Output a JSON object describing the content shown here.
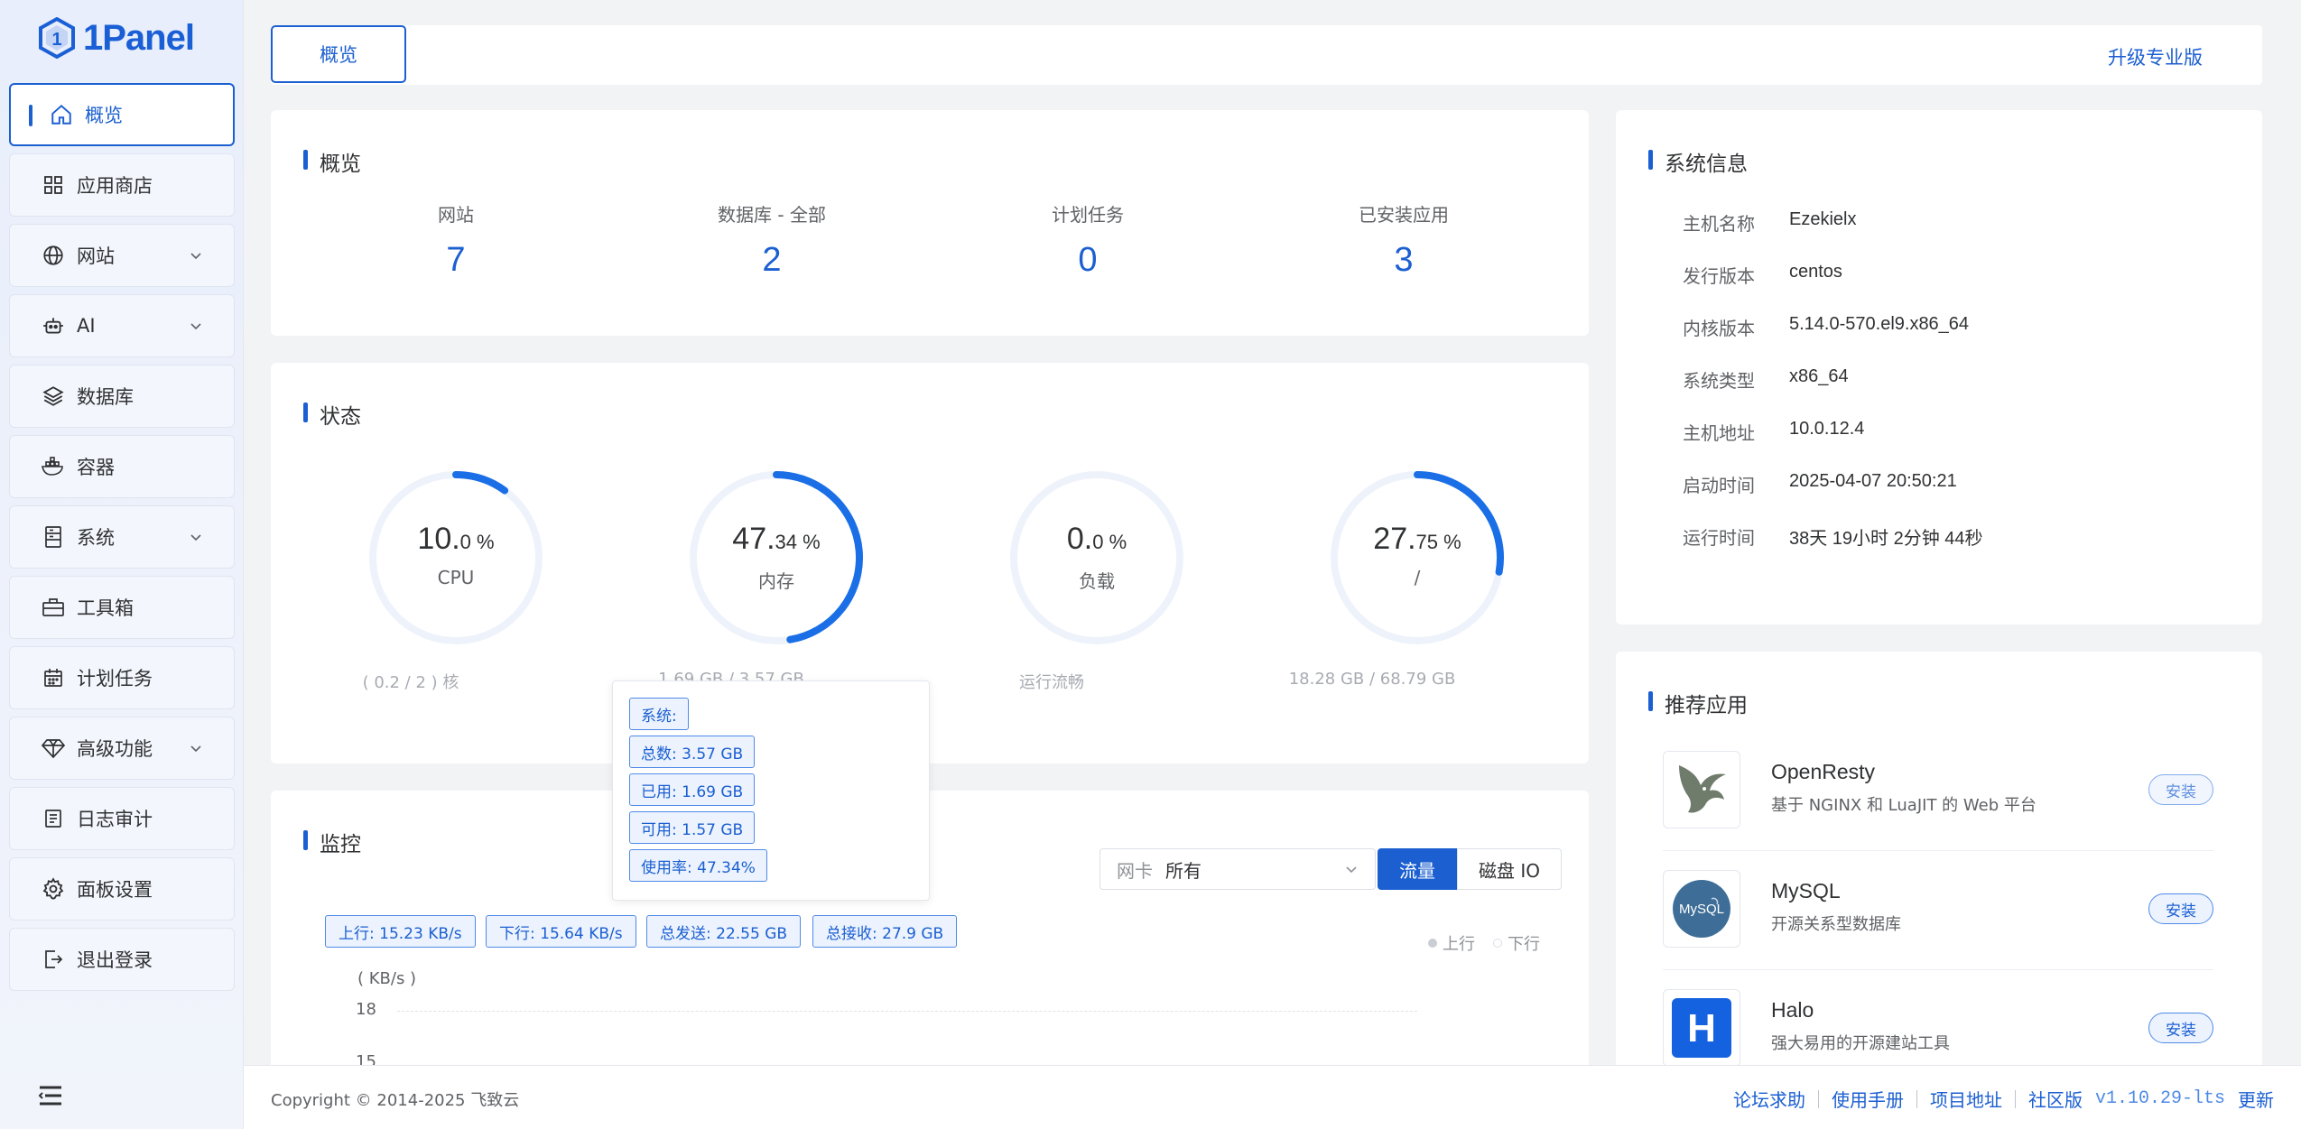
{
  "brand": {
    "name": "1Panel",
    "color": "#1b5fd1"
  },
  "sidebar": {
    "items": [
      {
        "label": "概览",
        "icon": "home-icon",
        "active": true,
        "expandable": false
      },
      {
        "label": "应用商店",
        "icon": "grid-icon",
        "active": false,
        "expandable": false
      },
      {
        "label": "网站",
        "icon": "globe-icon",
        "active": false,
        "expandable": true
      },
      {
        "label": "AI",
        "icon": "robot-icon",
        "active": false,
        "expandable": true
      },
      {
        "label": "数据库",
        "icon": "layers-icon",
        "active": false,
        "expandable": false
      },
      {
        "label": "容器",
        "icon": "docker-icon",
        "active": false,
        "expandable": false
      },
      {
        "label": "系统",
        "icon": "server-icon",
        "active": false,
        "expandable": true
      },
      {
        "label": "工具箱",
        "icon": "toolbox-icon",
        "active": false,
        "expandable": false
      },
      {
        "label": "计划任务",
        "icon": "calendar-icon",
        "active": false,
        "expandable": false
      },
      {
        "label": "高级功能",
        "icon": "diamond-icon",
        "active": false,
        "expandable": true
      },
      {
        "label": "日志审计",
        "icon": "log-icon",
        "active": false,
        "expandable": false
      },
      {
        "label": "面板设置",
        "icon": "gear-icon",
        "active": false,
        "expandable": false
      },
      {
        "label": "退出登录",
        "icon": "logout-icon",
        "active": false,
        "expandable": false
      }
    ]
  },
  "topbar": {
    "tab": "概览",
    "upgrade": "升级专业版"
  },
  "overview": {
    "title": "概览",
    "stats": [
      {
        "label": "网站",
        "value": "7"
      },
      {
        "label": "数据库 - 全部",
        "value": "2"
      },
      {
        "label": "计划任务",
        "value": "0"
      },
      {
        "label": "已安装应用",
        "value": "3"
      }
    ]
  },
  "status": {
    "title": "状态",
    "gauges": [
      {
        "int": "10.",
        "dec": "0 %",
        "label": "CPU",
        "percent": 10.0,
        "sub": "( 0.2 / 2 ) 核"
      },
      {
        "int": "47.",
        "dec": "34 %",
        "label": "内存",
        "percent": 47.34,
        "sub": "1.69 GB / 3.57 GB"
      },
      {
        "int": "0.",
        "dec": "0 %",
        "label": "负载",
        "percent": 0.0,
        "sub": "运行流畅"
      },
      {
        "int": "27.",
        "dec": "75 %",
        "label": "/",
        "percent": 27.75,
        "sub": "18.28 GB / 68.79 GB"
      }
    ]
  },
  "tooltip": {
    "items": [
      "系统:",
      "总数: 3.57 GB",
      "已用: 1.69 GB",
      "可用: 1.57 GB",
      "使用率: 47.34%"
    ]
  },
  "monitor": {
    "title": "监控",
    "nic_prefix": "网卡",
    "nic_value": "所有",
    "btn_traffic": "流量",
    "btn_diskio": "磁盘 IO",
    "tags": [
      "上行: 15.23 KB/s",
      "下行: 15.64 KB/s",
      "总发送: 22.55 GB",
      "总接收: 27.9 GB"
    ],
    "legend": [
      {
        "label": "上行",
        "color": "#c9cdd4"
      },
      {
        "label": "下行",
        "color": "#e6e8eb"
      }
    ],
    "unit": "( KB/s )",
    "y_ticks": [
      "18",
      "15"
    ]
  },
  "sysinfo": {
    "title": "系统信息",
    "rows": [
      {
        "k": "主机名称",
        "v": "Ezekielx"
      },
      {
        "k": "发行版本",
        "v": "centos"
      },
      {
        "k": "内核版本",
        "v": "5.14.0-570.el9.x86_64"
      },
      {
        "k": "系统类型",
        "v": "x86_64"
      },
      {
        "k": "主机地址",
        "v": "10.0.12.4"
      },
      {
        "k": "启动时间",
        "v": "2025-04-07 20:50:21"
      },
      {
        "k": "运行时间",
        "v": "38天 19小时 2分钟 44秒"
      }
    ]
  },
  "apps": {
    "title": "推荐应用",
    "items": [
      {
        "name": "OpenResty",
        "desc": "基于 NGINX 和 LuaJIT 的 Web 平台",
        "btn": "安装",
        "icon": "openresty-icon"
      },
      {
        "name": "MySQL",
        "desc": "开源关系型数据库",
        "btn": "安装",
        "icon": "mysql-icon"
      },
      {
        "name": "Halo",
        "desc": "强大易用的开源建站工具",
        "btn": "安装",
        "icon": "halo-icon"
      }
    ]
  },
  "footer": {
    "copyright": "Copyright © 2014-2025 飞致云",
    "links": [
      "论坛求助",
      "使用手册",
      "项目地址",
      "社区版"
    ],
    "version": "v1.10.29-lts",
    "update": "更新"
  }
}
